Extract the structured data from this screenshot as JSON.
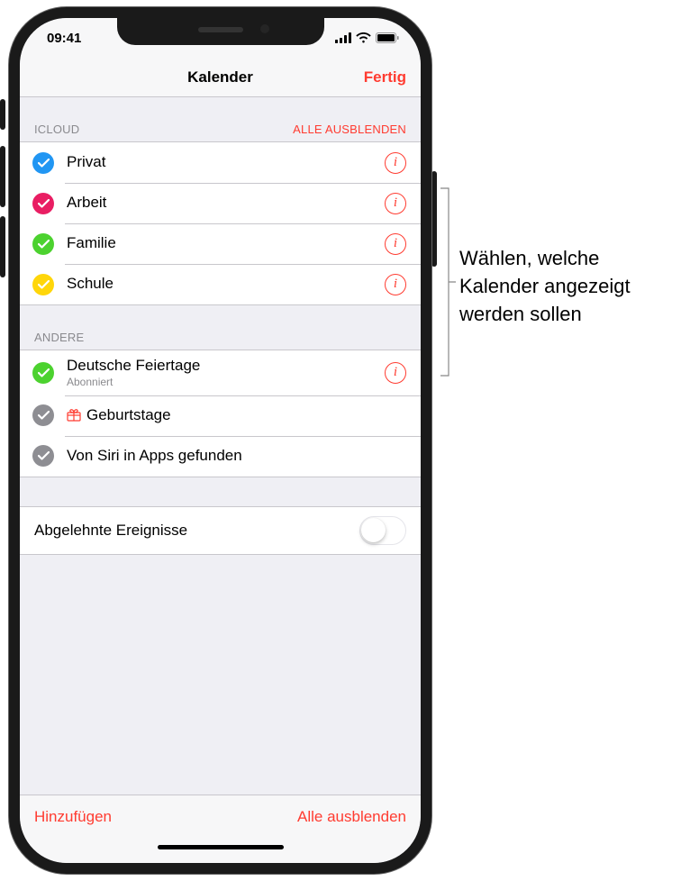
{
  "status": {
    "time": "09:41"
  },
  "nav": {
    "title": "Kalender",
    "done": "Fertig"
  },
  "sections": {
    "icloud": {
      "header": "ICLOUD",
      "hide_all": "ALLE AUSBLENDEN",
      "items": [
        {
          "label": "Privat",
          "color": "#2196f3"
        },
        {
          "label": "Arbeit",
          "color": "#e91e63"
        },
        {
          "label": "Familie",
          "color": "#4cd22f"
        },
        {
          "label": "Schule",
          "color": "#ffd60a"
        }
      ]
    },
    "other": {
      "header": "ANDERE",
      "items": [
        {
          "label": "Deutsche Feiertage",
          "sub": "Abonniert",
          "color": "#4cd22f",
          "info": true
        },
        {
          "label": "Geburtstage",
          "color": "#8e8e93",
          "gift": true
        },
        {
          "label": "Von Siri in Apps gefunden",
          "color": "#8e8e93"
        }
      ]
    }
  },
  "declined": {
    "label": "Abgelehnte Ereignisse"
  },
  "toolbar": {
    "add": "Hinzufügen",
    "hide_all": "Alle ausblenden"
  },
  "callout": "Wählen, welche Kalender angezeigt werden sollen"
}
